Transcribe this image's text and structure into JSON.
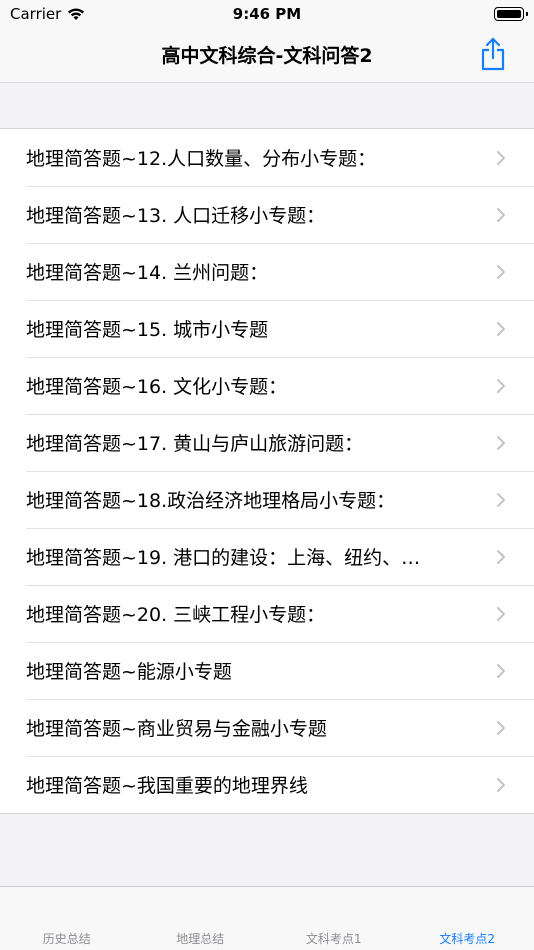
{
  "status_bar": {
    "carrier": "Carrier",
    "time": "9:46 PM"
  },
  "nav": {
    "title": "高中文科综合-文科问答2"
  },
  "list": {
    "items": [
      {
        "label": "地理简答题~12.人口数量、分布小专题："
      },
      {
        "label": "地理简答题~13. 人口迁移小专题："
      },
      {
        "label": "地理简答题~14. 兰州问题："
      },
      {
        "label": "地理简答题~15. 城市小专题"
      },
      {
        "label": "地理简答题~16. 文化小专题："
      },
      {
        "label": "地理简答题~17. 黄山与庐山旅游问题："
      },
      {
        "label": "地理简答题~18.政治经济地理格局小专题："
      },
      {
        "label": "地理简答题~19. 港口的建设：上海、纽约、…"
      },
      {
        "label": "地理简答题~20. 三峡工程小专题："
      },
      {
        "label": "地理简答题~能源小专题"
      },
      {
        "label": "地理简答题~商业贸易与金融小专题"
      },
      {
        "label": "地理简答题~我国重要的地理界线"
      }
    ]
  },
  "tabs": [
    {
      "label": "历史总结"
    },
    {
      "label": "地理总结"
    },
    {
      "label": "文科考点1"
    },
    {
      "label": "文科考点2"
    }
  ],
  "colors": {
    "accent": "#147efb",
    "inactive_tab": "#8e8e93"
  }
}
